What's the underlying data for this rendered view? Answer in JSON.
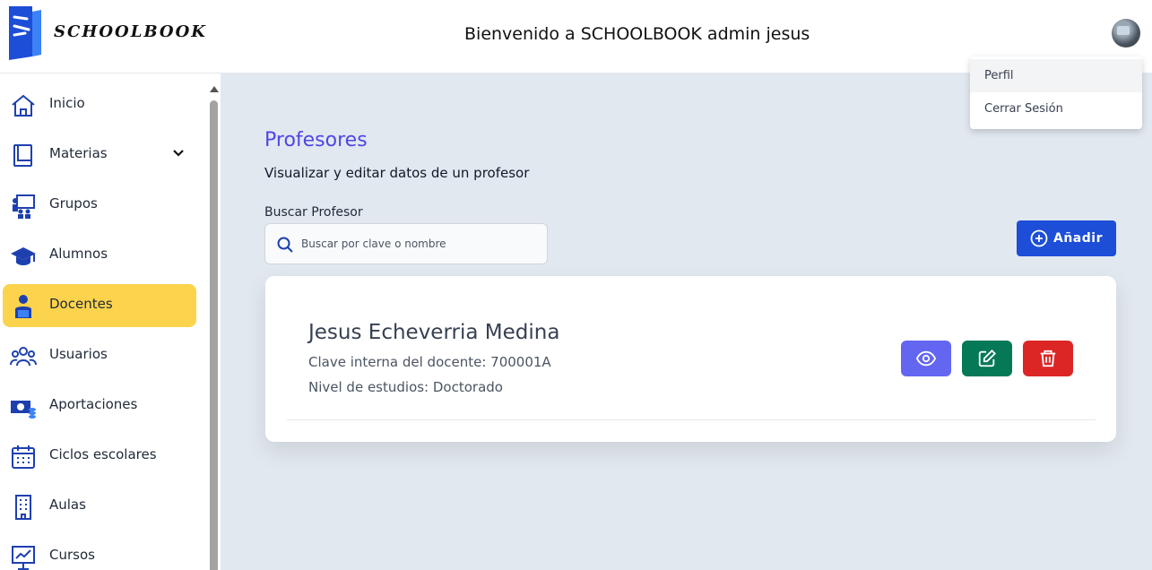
{
  "header": {
    "logo_text": "SCHOOLBOOK",
    "welcome": "Bienvenido a SCHOOLBOOK admin jesus"
  },
  "user_menu": {
    "items": [
      {
        "label": "Perfil"
      },
      {
        "label": "Cerrar Sesión"
      }
    ]
  },
  "sidebar": {
    "items": [
      {
        "label": "Inicio",
        "icon": "home-icon"
      },
      {
        "label": "Materias",
        "icon": "book-icon",
        "expandable": true
      },
      {
        "label": "Grupos",
        "icon": "group-icon"
      },
      {
        "label": "Alumnos",
        "icon": "graduation-cap-icon"
      },
      {
        "label": "Docentes",
        "icon": "teacher-icon",
        "active": true
      },
      {
        "label": "Usuarios",
        "icon": "users-icon"
      },
      {
        "label": "Aportaciones",
        "icon": "money-icon"
      },
      {
        "label": "Ciclos escolares",
        "icon": "calendar-icon"
      },
      {
        "label": "Aulas",
        "icon": "building-icon"
      },
      {
        "label": "Cursos",
        "icon": "chart-board-icon"
      }
    ]
  },
  "main": {
    "title": "Profesores",
    "subtitle": "Visualizar y editar datos de un profesor",
    "search": {
      "label": "Buscar Profesor",
      "placeholder": "Buscar por clave o nombre",
      "value": ""
    },
    "add_button": "Añadir",
    "teacher": {
      "name": "Jesus Echeverria Medina",
      "key": "Clave interna del docente: 700001A",
      "level": "Nivel de estudios: Doctorado"
    }
  },
  "colors": {
    "accent": "#4f46e5",
    "active_nav": "#fcd34d",
    "add_button": "#1d4ed8",
    "view": "#6366f1",
    "edit": "#047857",
    "delete": "#dc2626",
    "icon_blue": "#1e40af"
  }
}
